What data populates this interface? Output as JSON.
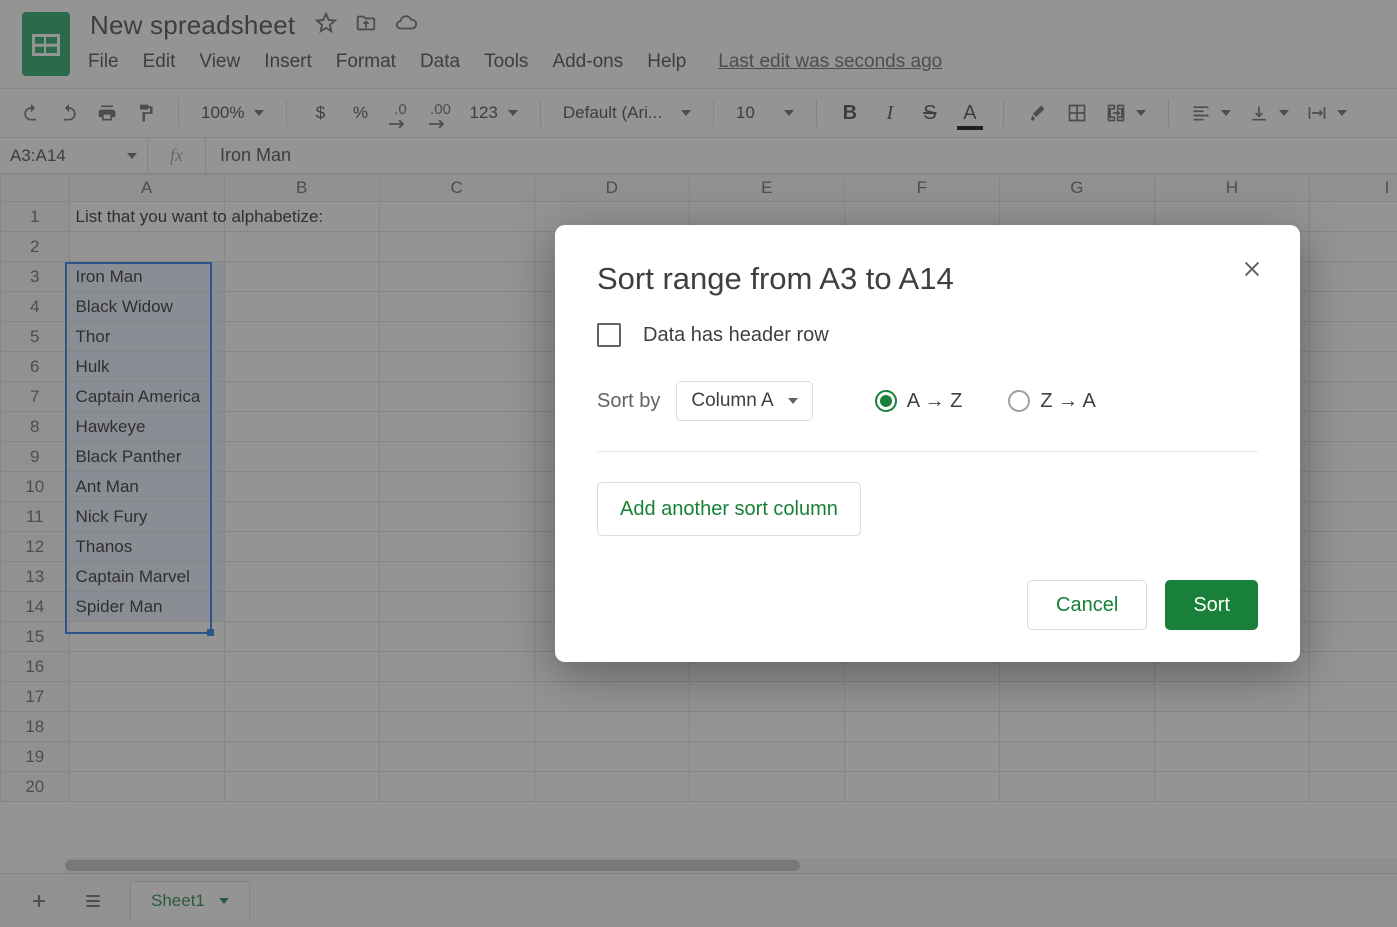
{
  "doc": {
    "title": "New spreadsheet"
  },
  "last_edit": "Last edit was seconds ago",
  "menus": [
    "File",
    "Edit",
    "View",
    "Insert",
    "Format",
    "Data",
    "Tools",
    "Add-ons",
    "Help"
  ],
  "toolbar": {
    "zoom": "100%",
    "currency": "$",
    "percent": "%",
    "dec_dec": ".0",
    "inc_dec": ".00",
    "numfmt": "123",
    "font": "Default (Ari...",
    "font_size": "10"
  },
  "name_box": "A3:A14",
  "fx_label": "fx",
  "formula": "Iron Man",
  "columns": [
    "A",
    "B",
    "C",
    "D",
    "E",
    "F",
    "G",
    "H",
    "I"
  ],
  "rows": [
    {
      "n": 1,
      "A": "List that you want to alphabetize:"
    },
    {
      "n": 2,
      "A": ""
    },
    {
      "n": 3,
      "A": "Iron Man"
    },
    {
      "n": 4,
      "A": "Black Widow"
    },
    {
      "n": 5,
      "A": "Thor"
    },
    {
      "n": 6,
      "A": "Hulk"
    },
    {
      "n": 7,
      "A": "Captain America"
    },
    {
      "n": 8,
      "A": "Hawkeye"
    },
    {
      "n": 9,
      "A": "Black Panther"
    },
    {
      "n": 10,
      "A": "Ant Man"
    },
    {
      "n": 11,
      "A": "Nick Fury"
    },
    {
      "n": 12,
      "A": "Thanos"
    },
    {
      "n": 13,
      "A": "Captain Marvel"
    },
    {
      "n": 14,
      "A": "Spider Man"
    },
    {
      "n": 15,
      "A": ""
    },
    {
      "n": 16,
      "A": ""
    },
    {
      "n": 17,
      "A": ""
    },
    {
      "n": 18,
      "A": ""
    },
    {
      "n": 19,
      "A": ""
    },
    {
      "n": 20,
      "A": ""
    }
  ],
  "sheet_tab": "Sheet1",
  "dialog": {
    "title": "Sort range from A3 to A14",
    "header_checkbox_label": "Data has header row",
    "sort_by_label": "Sort by",
    "column_drop": "Column A",
    "az": "A → Z",
    "za": "Z → A",
    "add_col": "Add another sort column",
    "cancel": "Cancel",
    "sort": "Sort"
  }
}
